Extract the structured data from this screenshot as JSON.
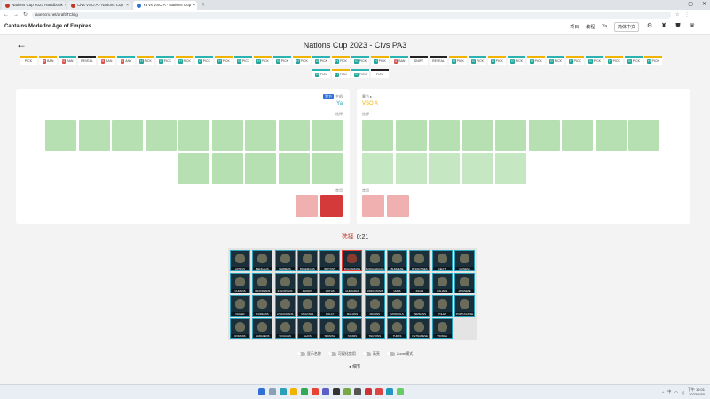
{
  "browser": {
    "tabs": [
      {
        "label": "Nations Cup 2023 Handbook",
        "active": false,
        "favicon": "red"
      },
      {
        "label": "Civs VSO A - Nations Cup",
        "active": false,
        "favicon": "red"
      },
      {
        "label": "Ya vs VSO A - Nations Cup",
        "active": true,
        "favicon": "blue"
      }
    ],
    "new_tab": "+",
    "url": "aoe2cm.net/draft/TCkilg"
  },
  "app": {
    "brand": "Captains Mode for Age of Empires",
    "nav": [
      "项目",
      "教程",
      "Ya",
      "简体中文"
    ],
    "title": "Nations Cup 2023 - Civs PA3"
  },
  "turns_row1": [
    {
      "label": "PICK",
      "tag": "",
      "kind": "host"
    },
    {
      "label": "BAN",
      "tag": "H",
      "tagc": "red",
      "kind": "host"
    },
    {
      "label": "BAN",
      "tag": "G",
      "tagc": "red",
      "kind": "guest"
    },
    {
      "label": "REVEAL",
      "tag": "",
      "kind": "par"
    },
    {
      "label": "BAN",
      "tag": "H",
      "tagc": "red",
      "kind": "host"
    },
    {
      "label": "ANY",
      "tag": "G",
      "tagc": "red",
      "kind": "guest"
    },
    {
      "label": "PICK",
      "tag": "H",
      "tagc": "teal",
      "kind": "host"
    },
    {
      "label": "PICK",
      "tag": "G",
      "tagc": "teal",
      "kind": "guest"
    },
    {
      "label": "PICK",
      "tag": "H",
      "tagc": "teal",
      "kind": "host"
    },
    {
      "label": "PICK",
      "tag": "G",
      "tagc": "teal",
      "kind": "guest"
    },
    {
      "label": "PICK",
      "tag": "H",
      "tagc": "teal",
      "kind": "host"
    },
    {
      "label": "PICK",
      "tag": "G",
      "tagc": "teal",
      "kind": "guest"
    },
    {
      "label": "PICK",
      "tag": "H",
      "tagc": "teal",
      "kind": "host"
    },
    {
      "label": "PICK",
      "tag": "G",
      "tagc": "teal",
      "kind": "guest"
    },
    {
      "label": "PICK",
      "tag": "H",
      "tagc": "teal",
      "kind": "host"
    },
    {
      "label": "PICK",
      "tag": "G",
      "tagc": "teal",
      "kind": "guest"
    },
    {
      "label": "PICK",
      "tag": "H",
      "tagc": "teal",
      "kind": "host"
    },
    {
      "label": "PICK",
      "tag": "G",
      "tagc": "teal",
      "kind": "guest"
    },
    {
      "label": "PICK",
      "tag": "H",
      "tagc": "teal",
      "kind": "host"
    },
    {
      "label": "BAN",
      "tag": "G",
      "tagc": "red",
      "kind": "guest"
    },
    {
      "label": "SNIPE",
      "tag": "",
      "kind": "par"
    },
    {
      "label": "REVEAL",
      "tag": "",
      "kind": "par"
    },
    {
      "label": "PICK",
      "tag": "H",
      "tagc": "teal",
      "kind": "host"
    },
    {
      "label": "PICK",
      "tag": "G",
      "tagc": "teal",
      "kind": "guest"
    },
    {
      "label": "PICK",
      "tag": "H",
      "tagc": "teal",
      "kind": "host"
    },
    {
      "label": "PICK",
      "tag": "G",
      "tagc": "teal",
      "kind": "guest"
    },
    {
      "label": "PICK",
      "tag": "H",
      "tagc": "teal",
      "kind": "host"
    },
    {
      "label": "PICK",
      "tag": "G",
      "tagc": "teal",
      "kind": "guest"
    },
    {
      "label": "PICK",
      "tag": "H",
      "tagc": "teal",
      "kind": "host"
    },
    {
      "label": "PICK",
      "tag": "G",
      "tagc": "teal",
      "kind": "guest"
    },
    {
      "label": "PICK",
      "tag": "H",
      "tagc": "teal",
      "kind": "host"
    },
    {
      "label": "PICK",
      "tag": "G",
      "tagc": "teal",
      "kind": "guest"
    },
    {
      "label": "PICK",
      "tag": "H",
      "tagc": "teal",
      "kind": "host"
    }
  ],
  "turns_row2": [
    {
      "label": "PICK",
      "tag": "G",
      "tagc": "teal",
      "kind": "guest"
    },
    {
      "label": "PICK",
      "tag": "H",
      "tagc": "teal",
      "kind": "host"
    },
    {
      "label": "PICK",
      "tag": "G",
      "tagc": "teal",
      "kind": "guest"
    },
    {
      "label": "PICK",
      "tag": "",
      "kind": "par"
    }
  ],
  "left_player": {
    "tag_pill": "我方",
    "tag_text": "主机",
    "name": "Ya",
    "picks_label": "选择",
    "bans_label": "禁用"
  },
  "right_player": {
    "tag_text": "客方 ▸",
    "name": "VSO A",
    "picks_label": "选择",
    "bans_label": "禁用"
  },
  "timer": {
    "who": "选择",
    "time": "0:21"
  },
  "civs": [
    "AZTECS",
    "BENGALIS",
    "BERBERS",
    "BOHEMIANS",
    "BRITONS",
    "BULGARIANS",
    "BURGUNDIANS",
    "BURMESE",
    "BYZANTINES",
    "CELTS",
    "CHINESE",
    "CUMANS",
    "DRAVIDIANS",
    "ETHIOPIANS",
    "FRANKS",
    "GOTHS",
    "GURJARAS",
    "HINDUSTANIS",
    "HUNS",
    "INCAS",
    "ITALIANS",
    "JAPANESE",
    "KHMER",
    "KOREANS",
    "LITHUANIANS",
    "MAGYARS",
    "MALAY",
    "MALIANS",
    "MAYANS",
    "MONGOLS",
    "PERSIANS",
    "POLES",
    "PORTUGUESE",
    "ROMANS",
    "SARACENS",
    "SICILIANS",
    "SLAVS",
    "SPANISH",
    "TATARS",
    "TEUTONS",
    "TURKS",
    "VIETNAMESE",
    "VIKINGS"
  ],
  "toggles": [
    "显示名称",
    "可视化禁用",
    "高亮",
    "Zoom模式"
  ],
  "details_label": "▸ 细节",
  "taskbar": {
    "time": "下午 12:01",
    "date": "2023/9/30",
    "lang": "中"
  }
}
